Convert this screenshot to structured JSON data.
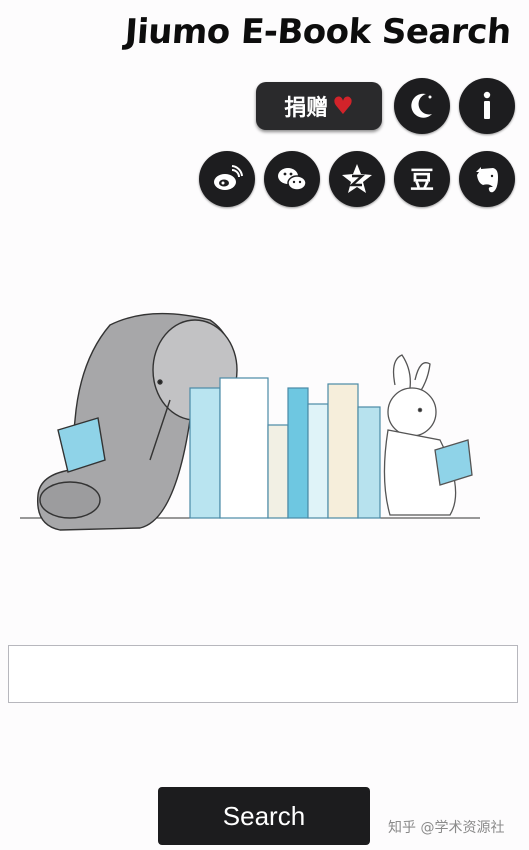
{
  "header": {
    "title": "Jiumo E-Book Search"
  },
  "toolbar": {
    "donate_label": "捐赠",
    "donate_heart": "♥",
    "info_glyph": "i"
  },
  "social": {
    "douban_glyph": "豆"
  },
  "search": {
    "placeholder": "",
    "button_label": "Search"
  },
  "watermark": "知乎 @学术资源社",
  "icons": {
    "donate": "heart-icon",
    "night_mode": "moon-icon",
    "about": "info-icon",
    "share": [
      "weibo-icon",
      "wechat-icon",
      "qzone-icon",
      "douban-icon",
      "evernote-icon"
    ]
  },
  "colors": {
    "button_bg": "#1c1c1e",
    "heart": "#d2232a",
    "page_bg": "#fdfcfd"
  }
}
